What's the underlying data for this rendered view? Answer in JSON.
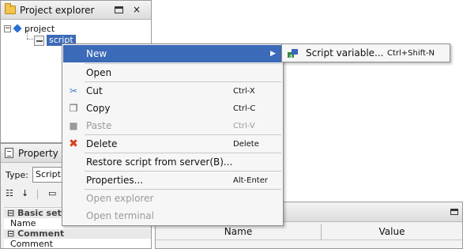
{
  "explorer": {
    "title": "Project explorer",
    "close_glyph": "×",
    "tree": {
      "project_label": "project",
      "script_label": "script"
    },
    "icons": [
      "folder-icon",
      "maximize-icon",
      "close-icon",
      "collapse-icon",
      "project-icon",
      "script-file-icon"
    ]
  },
  "property": {
    "title": "Property",
    "type_label": "Type:",
    "type_value": "Script",
    "categories": {
      "basic": "Basic setting",
      "comment": "Comment"
    },
    "rows": {
      "name": "Name",
      "comment": "Comment"
    }
  },
  "values_panel": {
    "columns": [
      "Name",
      "Value"
    ]
  },
  "context_menu": {
    "items": [
      {
        "label": "New",
        "shortcut": "",
        "state": "highlighted",
        "has_submenu": true
      },
      {
        "label": "Open",
        "shortcut": "",
        "state": "enabled"
      },
      {
        "label": "Cut",
        "shortcut": "Ctrl-X",
        "state": "enabled",
        "icon": "scissors-icon"
      },
      {
        "label": "Copy",
        "shortcut": "Ctrl-C",
        "state": "enabled",
        "icon": "copy-icon"
      },
      {
        "label": "Paste",
        "shortcut": "Ctrl-V",
        "state": "disabled",
        "icon": "paste-icon"
      },
      {
        "label": "Delete",
        "shortcut": "Delete",
        "state": "enabled",
        "icon": "delete-icon"
      },
      {
        "label": "Restore script from server(B)...",
        "shortcut": "",
        "state": "enabled"
      },
      {
        "label": "Properties...",
        "shortcut": "Alt-Enter",
        "state": "enabled"
      },
      {
        "label": "Open explorer",
        "shortcut": "",
        "state": "disabled"
      },
      {
        "label": "Open terminal",
        "shortcut": "",
        "state": "disabled"
      }
    ]
  },
  "submenu": {
    "label": "Script variable...",
    "shortcut": "Ctrl+Shift-N",
    "icon": "script-variable-icon"
  },
  "colors": {
    "selection": "#3b6ab8",
    "disabled_text": "#9a9a9a",
    "delete_icon": "#d9401f"
  }
}
